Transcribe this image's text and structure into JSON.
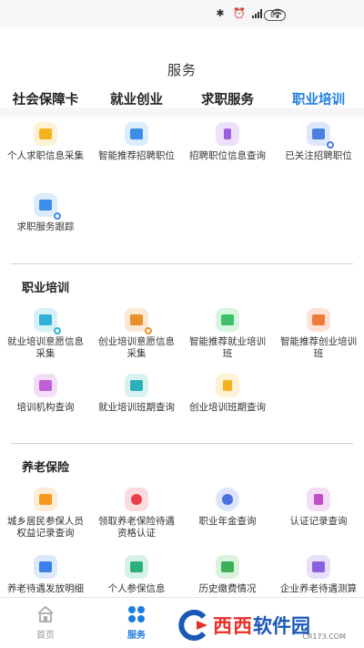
{
  "statusbar": {
    "battery": "89"
  },
  "page": {
    "title": "服务"
  },
  "tabs": [
    {
      "label": "社会保障卡"
    },
    {
      "label": "就业创业"
    },
    {
      "label": "求职服务"
    },
    {
      "label": "职业培训"
    }
  ],
  "job_items": [
    {
      "label": "个人求职信息采集",
      "icon": "profile-icon",
      "color": "#f5b21e"
    },
    {
      "label": "智能推荐招聘职位",
      "icon": "briefcase-icon",
      "color": "#3b8fe8"
    },
    {
      "label": "招聘职位信息查询",
      "icon": "tie-icon",
      "color": "#9b5fe0"
    },
    {
      "label": "已关注招聘职位",
      "icon": "star-doc-icon",
      "color": "#4a7fe0"
    },
    {
      "label": "求职服务跟踪",
      "icon": "tracking-icon",
      "color": "#3b8fe8"
    }
  ],
  "training": {
    "title": "职业培训",
    "items": [
      {
        "label": "就业培训意愿信息采集",
        "icon": "employ-survey-icon",
        "color": "#2eb0d8"
      },
      {
        "label": "创业培训意愿信息采集",
        "icon": "startup-survey-icon",
        "color": "#e8902a"
      },
      {
        "label": "智能推荐就业培训班",
        "icon": "employ-class-icon",
        "color": "#3cc06a"
      },
      {
        "label": "智能推荐创业培训班",
        "icon": "startup-class-icon",
        "color": "#f07a3a"
      },
      {
        "label": "培训机构查询",
        "icon": "institution-icon",
        "color": "#c060d8"
      },
      {
        "label": "就业培训班期查询",
        "icon": "employ-period-icon",
        "color": "#2eb0b8"
      },
      {
        "label": "创业培训班期查询",
        "icon": "startup-period-icon",
        "color": "#f5b21e"
      }
    ]
  },
  "pension": {
    "title": "养老保险",
    "items": [
      {
        "label": "城乡居民参保人员权益记录查询",
        "icon": "record-icon",
        "color": "#f59a1e"
      },
      {
        "label": "领取养老保险待遇资格认证",
        "icon": "certify-icon",
        "color": "#e8404a"
      },
      {
        "label": "职业年金查询",
        "icon": "annuity-icon",
        "color": "#4a6fe0"
      },
      {
        "label": "认证记录查询",
        "icon": "auth-record-icon",
        "color": "#c050c8"
      },
      {
        "label": "养老待遇发放明细",
        "icon": "payout-icon",
        "color": "#3b7fe8"
      },
      {
        "label": "个人参保信息",
        "icon": "insured-info-icon",
        "color": "#2eb07a"
      },
      {
        "label": "历史缴费情况",
        "icon": "payment-history-icon",
        "color": "#3cb05a"
      },
      {
        "label": "企业养老待遇测算",
        "icon": "calc-icon",
        "color": "#8a60e0"
      }
    ]
  },
  "bottom_nav": [
    {
      "label": "首页",
      "icon": "home-icon"
    },
    {
      "label": "服务",
      "icon": "services-icon"
    }
  ],
  "watermark": {
    "text_red": "西西",
    "text_blue": "软件园",
    "sub": "CR173.COM"
  }
}
